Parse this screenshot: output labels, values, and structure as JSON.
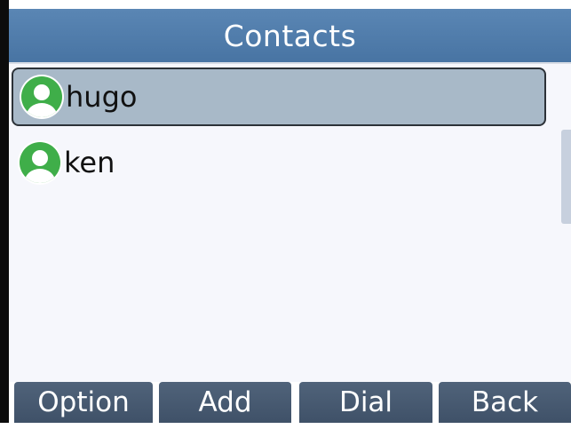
{
  "header": {
    "title": "Contacts"
  },
  "contacts": [
    {
      "name": "hugo",
      "selected": true
    },
    {
      "name": "ken",
      "selected": false
    }
  ],
  "softkeys": {
    "option": "Option",
    "add": "Add",
    "dial": "Dial",
    "back": "Back"
  },
  "colors": {
    "title_bar": "#4c78a6",
    "selected_row": "#a8b9c8",
    "softkey": "#475a70",
    "avatar": "#3fae49"
  }
}
